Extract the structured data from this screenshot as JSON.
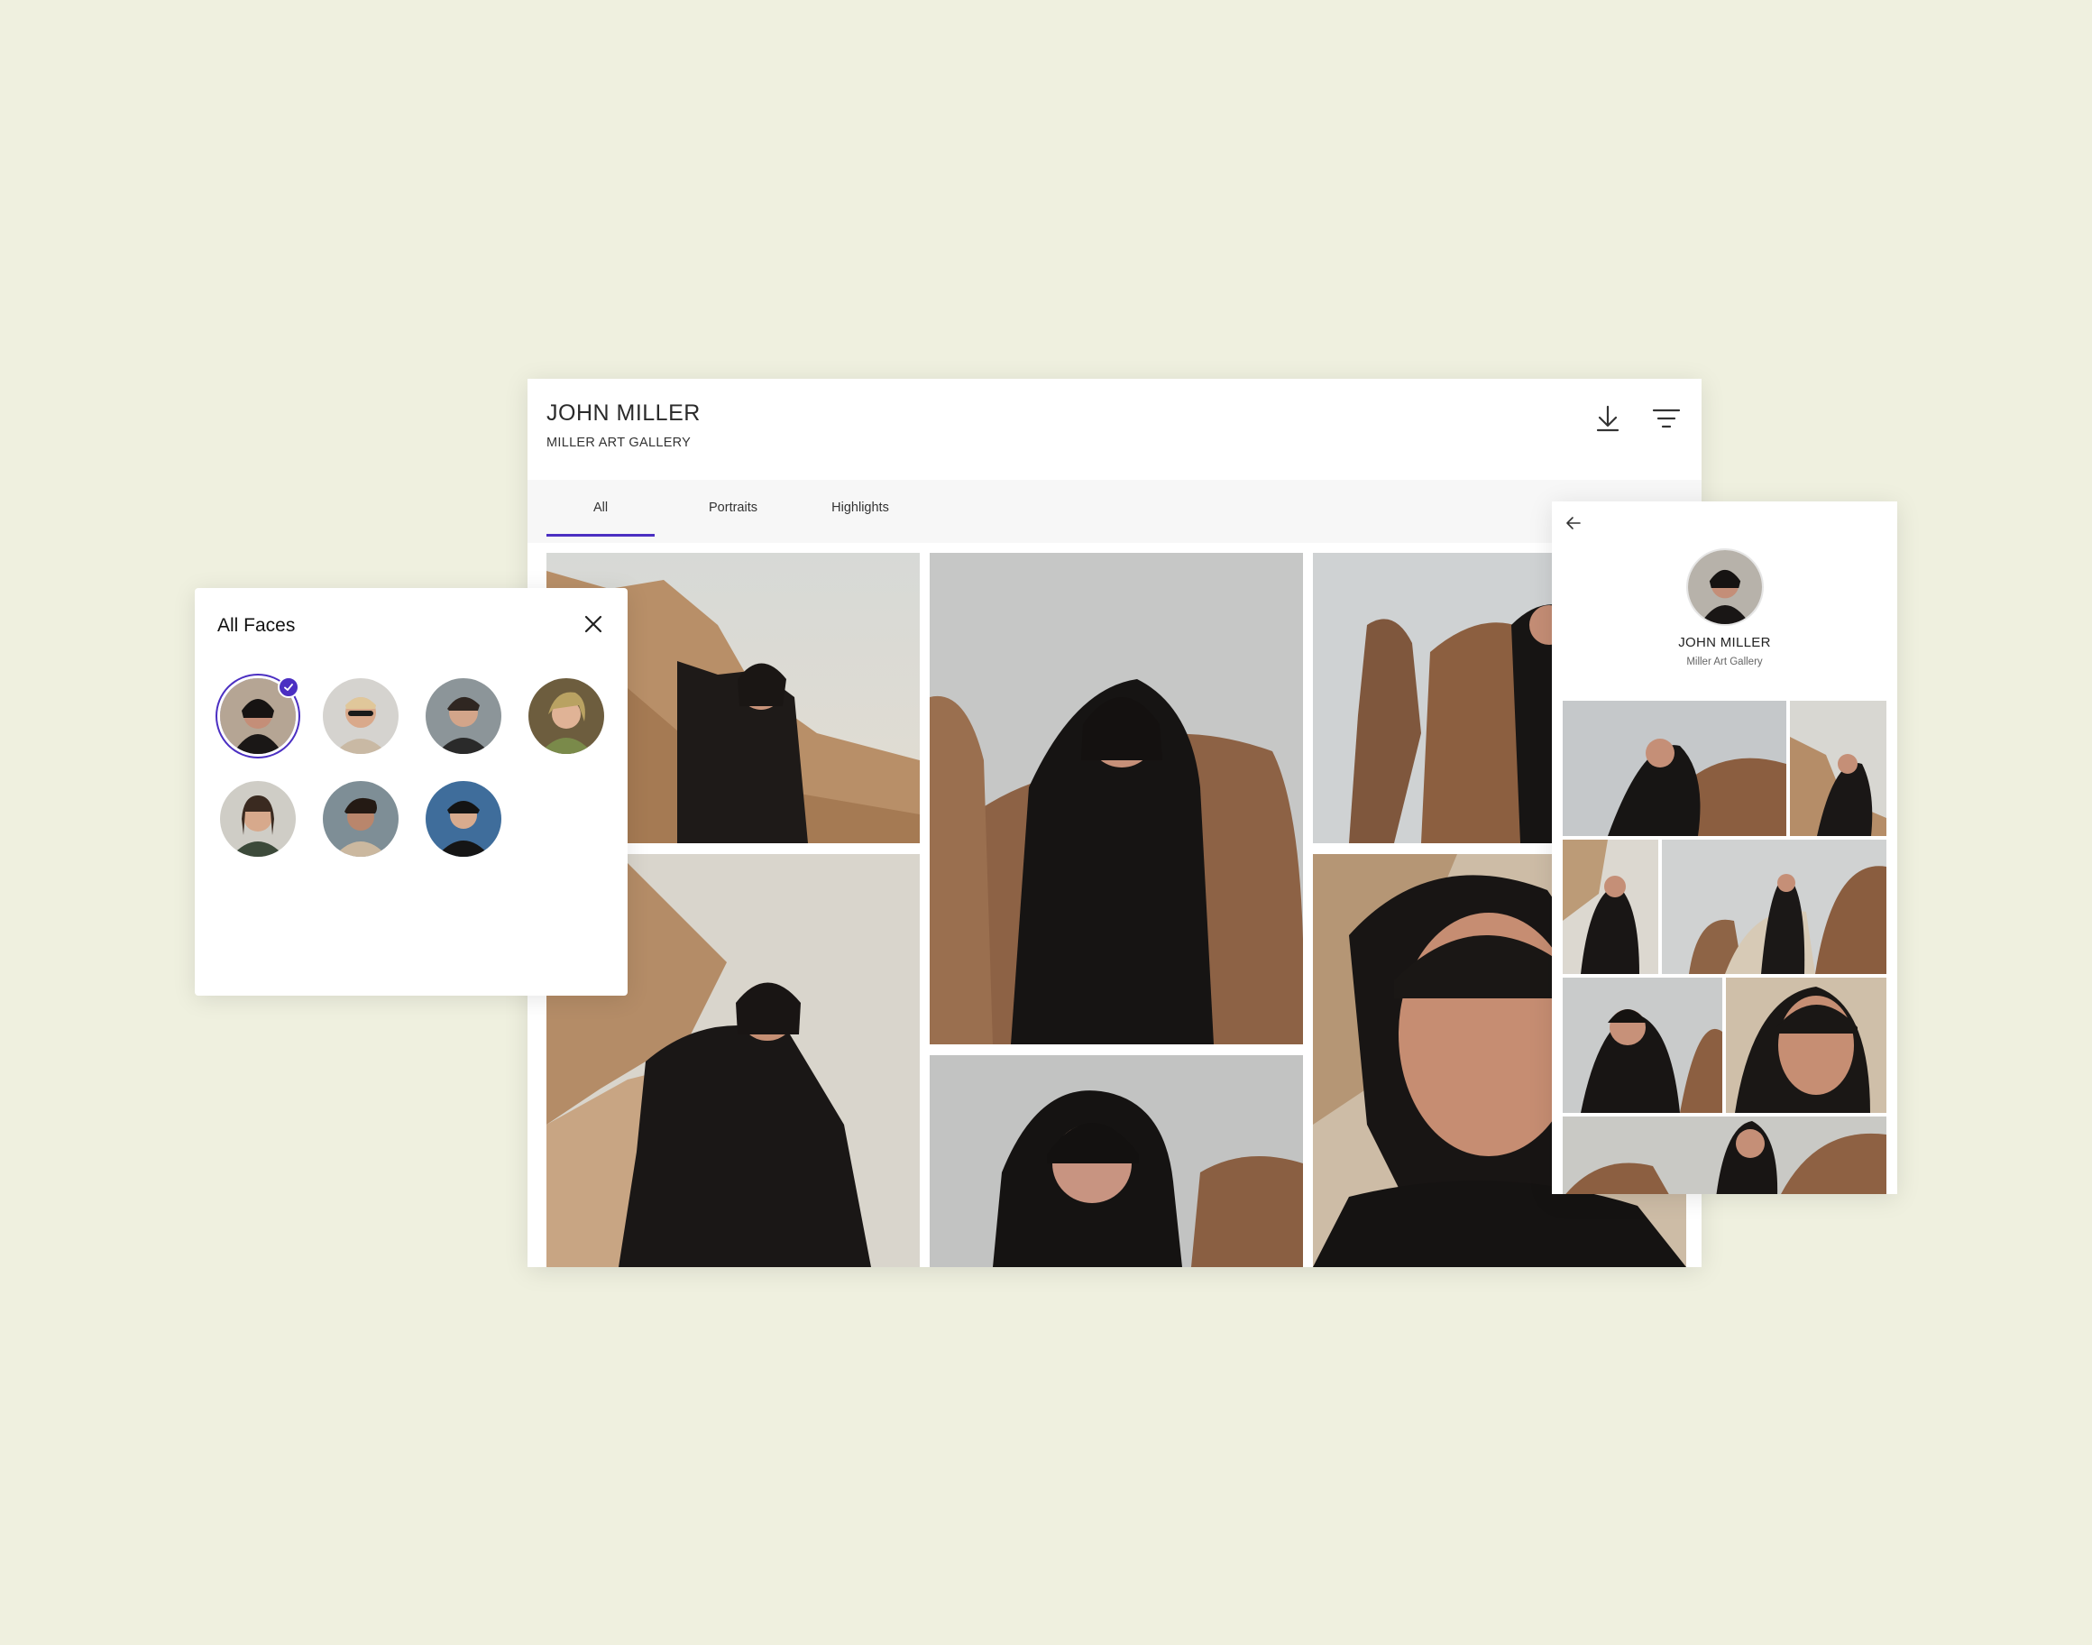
{
  "gallery": {
    "title": "JOHN MILLER",
    "subtitle": "MILLER ART GALLERY",
    "actions": [
      {
        "name": "download",
        "icon": "download-icon"
      },
      {
        "name": "filter",
        "icon": "filter-icon"
      }
    ],
    "tabs": [
      {
        "label": "All",
        "active": true
      },
      {
        "label": "Portraits",
        "active": false
      },
      {
        "label": "Highlights",
        "active": false
      }
    ]
  },
  "faces_panel": {
    "title": "All Faces",
    "close_icon": "close-icon",
    "selected_index": 0,
    "face_count": 7
  },
  "profile_panel": {
    "back_icon": "arrow-left-icon",
    "name": "JOHN MILLER",
    "subtitle": "Miller Art Gallery"
  },
  "colors": {
    "background": "#eff0df",
    "accent": "#4b2fc2",
    "card": "#ffffff",
    "tab_bar": "#f7f7f7"
  }
}
